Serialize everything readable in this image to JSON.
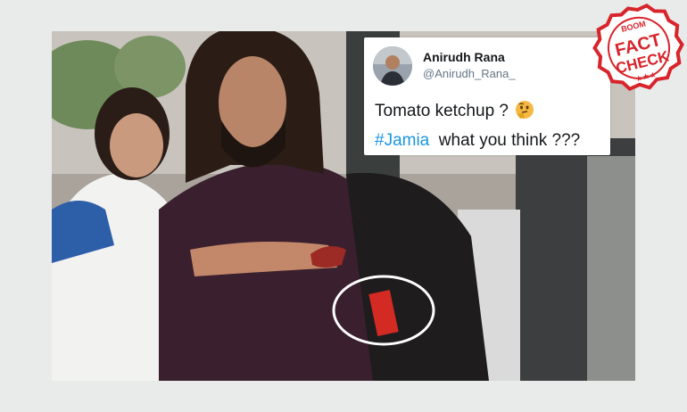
{
  "tweet": {
    "name": "Anirudh Rana",
    "handle": "@Anirudh_Rana_",
    "line1": "Tomato ketchup ?",
    "hashtag": "#Jamia",
    "line2_rest": "  what you think ???",
    "emoji": "thinking-face-icon"
  },
  "stamp": {
    "brand": "BOOM",
    "word1": "FACT",
    "word2": "CHECK",
    "color": "#d8242b"
  }
}
